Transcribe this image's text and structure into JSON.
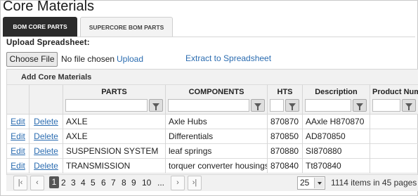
{
  "page": {
    "title": "Core Materials"
  },
  "tabs": [
    {
      "label": "BOM CORE PARTS",
      "active": true
    },
    {
      "label": "SUPERCORE BOM PARTS",
      "active": false
    }
  ],
  "upload": {
    "label": "Upload Spreadsheet:",
    "choose_button": "Choose File",
    "no_file": "No file chosen",
    "upload_link": "Upload",
    "extract_link": "Extract to Spreadsheet"
  },
  "grid": {
    "title": "Add Core Materials",
    "columns": [
      "PARTS",
      "COMPONENTS",
      "HTS",
      "Description",
      "Product Num"
    ],
    "edit_label": "Edit",
    "delete_label": "Delete",
    "rows": [
      {
        "parts": "AXLE",
        "components": "Axle Hubs",
        "hts": "870870",
        "description": "AAxle H870870",
        "product_num": ""
      },
      {
        "parts": "AXLE",
        "components": "Differentials",
        "hts": "870850",
        "description": "AD870850",
        "product_num": ""
      },
      {
        "parts": "SUSPENSION SYSTEM",
        "components": "leaf springs",
        "hts": "870880",
        "description": "SI870880",
        "product_num": ""
      },
      {
        "parts": "TRANSMISSION",
        "components": "torquer converter housings",
        "hts": "870840",
        "description": "Tt870840",
        "product_num": ""
      }
    ]
  },
  "pager": {
    "first_icon": "first-page-icon",
    "prev_icon": "prev-page-icon",
    "next_icon": "next-page-icon",
    "last_icon": "last-page-icon",
    "pages": [
      "1",
      "2",
      "3",
      "4",
      "5",
      "6",
      "7",
      "8",
      "9",
      "10",
      "..."
    ],
    "current_page": "1",
    "page_size": "25",
    "info": "1114 items in 45 pages"
  },
  "colors": {
    "link": "#2b6cb0",
    "active_tab": "#2b2b2b",
    "header_bg": "#f1f1f1"
  }
}
